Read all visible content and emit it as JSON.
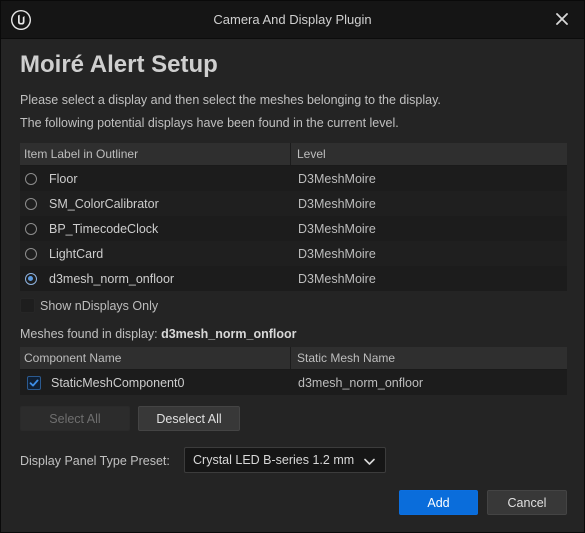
{
  "window": {
    "title": "Camera And Display Plugin"
  },
  "heading": "Moiré Alert Setup",
  "descriptions": [
    "Please select a display and then select the meshes belonging to the display.",
    "The following potential displays have been found in the current level."
  ],
  "displays_table": {
    "columns": [
      "Item Label in Outliner",
      "Level"
    ],
    "rows": [
      {
        "label": "Floor",
        "level": "D3MeshMoire",
        "selected": false
      },
      {
        "label": "SM_ColorCalibrator",
        "level": "D3MeshMoire",
        "selected": false
      },
      {
        "label": "BP_TimecodeClock",
        "level": "D3MeshMoire",
        "selected": false
      },
      {
        "label": "LightCard",
        "level": "D3MeshMoire",
        "selected": false
      },
      {
        "label": "d3mesh_norm_onfloor",
        "level": "D3MeshMoire",
        "selected": true
      }
    ]
  },
  "show_ndisplays_only": {
    "label": "Show nDisplays Only",
    "checked": false
  },
  "meshes_found": {
    "prefix": "Meshes found in display: ",
    "display_name": "d3mesh_norm_onfloor"
  },
  "meshes_table": {
    "columns": [
      "Component Name",
      "Static Mesh Name"
    ],
    "rows": [
      {
        "component": "StaticMeshComponent0",
        "mesh": "d3mesh_norm_onfloor",
        "checked": true
      }
    ]
  },
  "buttons": {
    "select_all": "Select All",
    "deselect_all": "Deselect All",
    "add": "Add",
    "cancel": "Cancel"
  },
  "preset": {
    "label": "Display Panel Type Preset:",
    "value": "Crystal LED B-series 1.2 mm"
  },
  "icons": {
    "logo": "unreal-engine-logo",
    "close": "close-icon",
    "dropdown": "chevron-down-icon",
    "check": "checkmark-icon"
  },
  "colors": {
    "accent": "#0a6ddb",
    "radio_selected": "#5a9ae0",
    "window_bg": "#242424",
    "titlebar_bg": "#151515"
  }
}
